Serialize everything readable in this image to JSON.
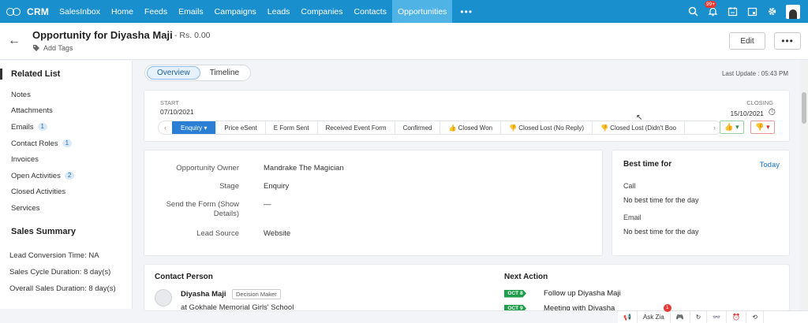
{
  "nav": {
    "brand": "CRM",
    "items": [
      {
        "label": "SalesInbox"
      },
      {
        "label": "Home"
      },
      {
        "label": "Feeds"
      },
      {
        "label": "Emails"
      },
      {
        "label": "Campaigns"
      },
      {
        "label": "Leads"
      },
      {
        "label": "Companies"
      },
      {
        "label": "Contacts"
      },
      {
        "label": "Opportunities",
        "active": true
      }
    ],
    "more": "•••",
    "notification_badge": "99+"
  },
  "header": {
    "title": "Opportunity for Diyasha Maji",
    "amount": "- Rs. 0.00",
    "add_tags": "Add Tags",
    "edit_label": "Edit",
    "more_label": "•••"
  },
  "sidebar": {
    "related_title": "Related List",
    "items": [
      {
        "label": "Notes",
        "count": ""
      },
      {
        "label": "Attachments",
        "count": ""
      },
      {
        "label": "Emails",
        "count": "1"
      },
      {
        "label": "Contact Roles",
        "count": "1"
      },
      {
        "label": "Invoices",
        "count": ""
      },
      {
        "label": "Open Activities",
        "count": "2"
      },
      {
        "label": "Closed Activities",
        "count": ""
      },
      {
        "label": "Services",
        "count": ""
      }
    ],
    "summary_title": "Sales Summary",
    "summary": [
      "Lead Conversion Time: NA",
      "Sales Cycle Duration: 8 day(s)",
      "Overall Sales Duration: 8 day(s)"
    ]
  },
  "tabs": {
    "overview": "Overview",
    "timeline": "Timeline"
  },
  "last_update": "Last Update : 05:43 PM",
  "stage": {
    "start_label": "START",
    "start_date": "07/10/2021",
    "closing_label": "CLOSING",
    "closing_date": "15/10/2021",
    "pipeline": [
      {
        "label": "Enquiry",
        "active": true
      },
      {
        "label": "Price eSent"
      },
      {
        "label": "E Form Sent"
      },
      {
        "label": "Received Event Form"
      },
      {
        "label": "Confirmed"
      },
      {
        "label": "Closed Won"
      },
      {
        "label": "Closed Lost (No Reply)"
      },
      {
        "label": "Closed Lost (Didn't Boo"
      }
    ]
  },
  "details": {
    "fields": [
      {
        "label": "Opportunity Owner",
        "value": "Mandrake The Magician"
      },
      {
        "label": "Stage",
        "value": "Enquiry"
      },
      {
        "label": "Send the Form (Show Details)",
        "value": "—"
      },
      {
        "label": "Lead Source",
        "value": "Website"
      }
    ]
  },
  "best_time": {
    "title": "Best time for",
    "today": "Today",
    "call_label": "Call",
    "call_value": "No best time for the day",
    "email_label": "Email",
    "email_value": "No best time for the day"
  },
  "contact": {
    "title": "Contact Person",
    "name": "Diyasha Maji",
    "role": "Decision Maker",
    "school": "at Gokhale Memorial Girls' School"
  },
  "next_action": {
    "title": "Next Action",
    "items": [
      {
        "date": "OCT 8",
        "text": "Follow up Diyasha Maji"
      },
      {
        "date": "OCT 9",
        "text": "Meeting with Diyasha"
      }
    ]
  },
  "bottombar": {
    "ask_zia": "Ask Zia",
    "badge": "1"
  }
}
